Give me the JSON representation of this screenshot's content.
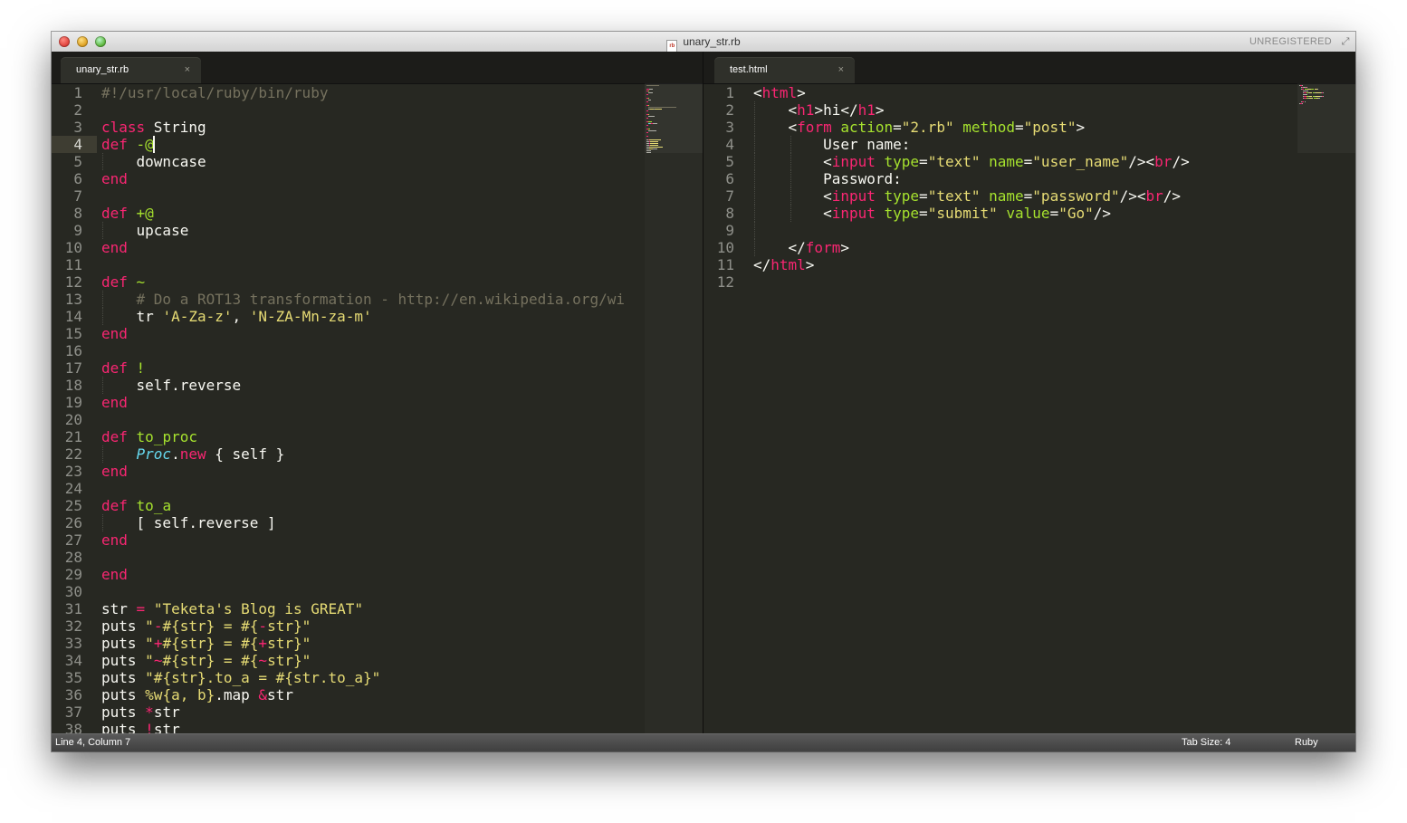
{
  "window": {
    "title": "unary_str.rb",
    "file_icon_text": "rb",
    "registration": "UNREGISTERED",
    "colors": {
      "background": "#272822",
      "keyword": "#f92672",
      "string": "#e6db74",
      "comment": "#75715e",
      "function": "#a6e22e",
      "type": "#66d9ef",
      "text": "#f8f8f2"
    }
  },
  "left_pane": {
    "tab": {
      "label": "unary_str.rb",
      "close": "×"
    },
    "current_line": 4
  },
  "right_pane": {
    "tab": {
      "label": "test.html",
      "close": "×"
    }
  },
  "status": {
    "position": "Line 4, Column 7",
    "tab_size": "Tab Size: 4",
    "syntax": "Ruby"
  }
}
